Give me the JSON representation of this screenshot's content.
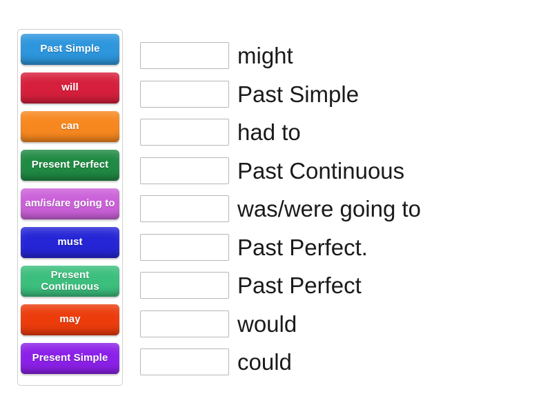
{
  "activity": {
    "type": "match-up",
    "tray": {
      "tiles": [
        {
          "label": "Past Simple",
          "color": "#2d96dd",
          "lines": 1
        },
        {
          "label": "will",
          "color": "#d61f3c",
          "lines": 1
        },
        {
          "label": "can",
          "color": "#f7881f",
          "lines": 1
        },
        {
          "label": "Present Perfect",
          "color": "#1f8a43",
          "lines": 2
        },
        {
          "label": "am/is/are going to",
          "color": "#cb61d9",
          "lines": 2
        },
        {
          "label": "must",
          "color": "#2525d6",
          "lines": 1
        },
        {
          "label": "Present Continuous",
          "color": "#3cbf7d",
          "lines": 2
        },
        {
          "label": "may",
          "color": "#ec3c0c",
          "lines": 1
        },
        {
          "label": "Present Simple",
          "color": "#8b20e8",
          "lines": 2
        }
      ]
    },
    "rows": [
      {
        "answer": "",
        "prompt": "might"
      },
      {
        "answer": "",
        "prompt": "Past Simple"
      },
      {
        "answer": "",
        "prompt": "had to"
      },
      {
        "answer": "",
        "prompt": "Past Continuous"
      },
      {
        "answer": "",
        "prompt": "was/were going to"
      },
      {
        "answer": "",
        "prompt": "Past Perfect."
      },
      {
        "answer": "",
        "prompt": "Past Perfect"
      },
      {
        "answer": "",
        "prompt": "would"
      },
      {
        "answer": "",
        "prompt": "could"
      }
    ]
  }
}
